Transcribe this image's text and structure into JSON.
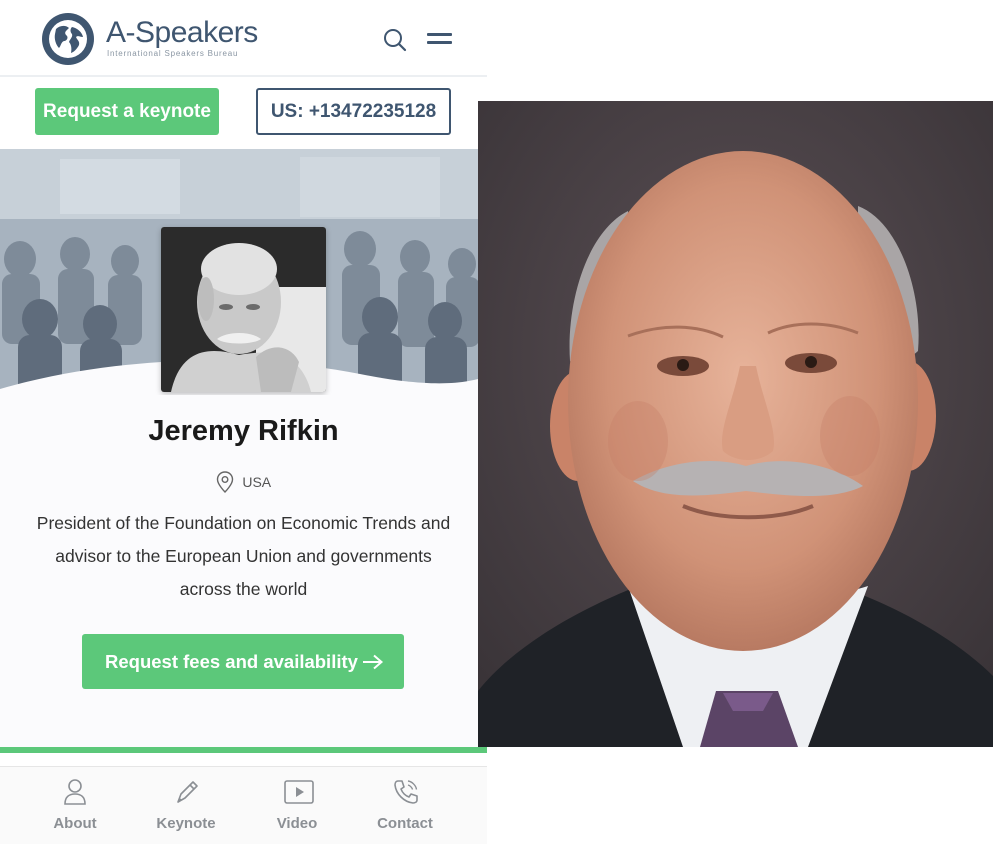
{
  "header": {
    "brand": "A-Speakers",
    "tagline": "International Speakers Bureau",
    "search_icon": "search-icon",
    "menu_icon": "hamburger-menu-icon"
  },
  "actions": {
    "request_keynote": "Request a keynote",
    "phone": "US: +13472235128"
  },
  "speaker": {
    "name": "Jeremy Rifkin",
    "location": "USA",
    "bio": "President of the Foundation on Economic Trends and advisor to the European Union and governments across the world",
    "cta": "Request fees and availability"
  },
  "progress": {
    "fraction": 1.0
  },
  "tabs": [
    {
      "label": "About",
      "icon": "person-icon"
    },
    {
      "label": "Keynote",
      "icon": "pen-icon"
    },
    {
      "label": "Video",
      "icon": "play-icon"
    },
    {
      "label": "Contact",
      "icon": "phone-icon"
    }
  ],
  "colors": {
    "accent_green": "#5cc87a",
    "brand_navy": "#3f5670"
  }
}
